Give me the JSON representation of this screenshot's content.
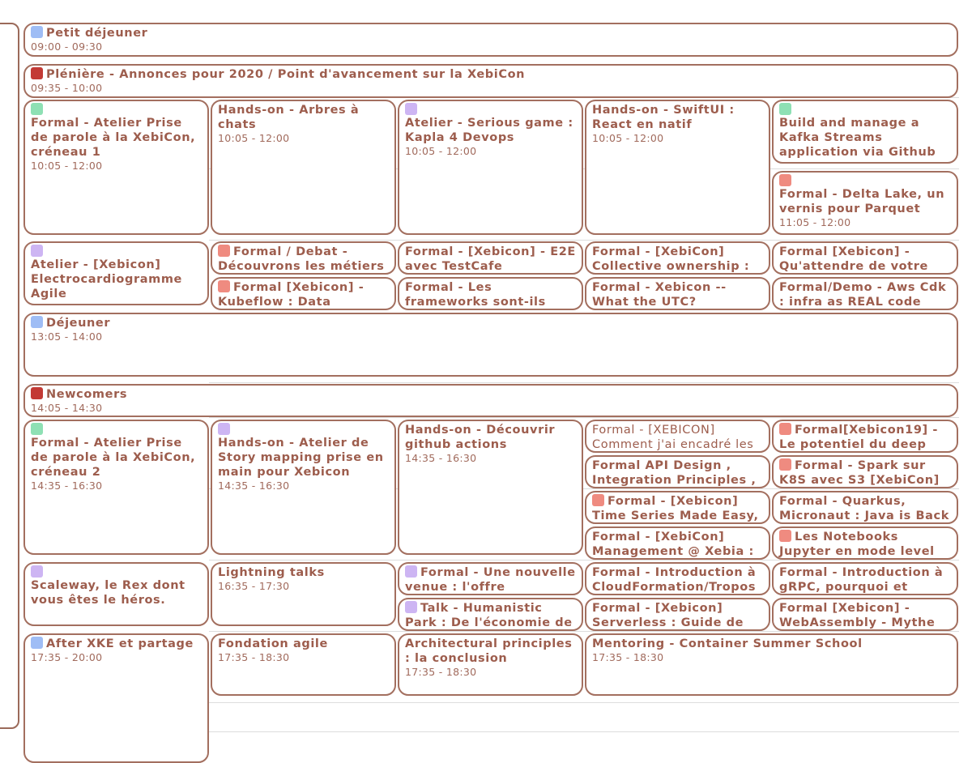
{
  "colors": {
    "border": "#a36f5f",
    "text": "#9d5d4d",
    "blue": "#9fbdf5",
    "red": "#c33a35",
    "green": "#8ee0b4",
    "purple": "#cdb5f3",
    "salmon": "#ef8b80"
  },
  "events": {
    "e1": {
      "title": "Petit déjeuner",
      "time": "09:00 - 09:30",
      "color": "blue"
    },
    "e2": {
      "title": "Plénière - Annonces pour 2020 / Point d'avancement sur la XebiCon",
      "time": "09:35 - 10:00",
      "color": "red"
    },
    "e3": {
      "title": "Formal - Atelier Prise de parole à la XebiCon, créneau 1",
      "time": "10:05 - 12:00",
      "color": "green"
    },
    "e4": {
      "title": "Hands-on - Arbres à chats",
      "time": "10:05 - 12:00"
    },
    "e5": {
      "title": "Atelier - Serious game : Kapla 4 Devops",
      "time": "10:05 - 12:00",
      "color": "purple"
    },
    "e6": {
      "title": "Hands-on - SwiftUI : React en natif",
      "time": "10:05 - 12:00"
    },
    "e7": {
      "title": "Build and manage a Kafka Streams application via Github",
      "color": "green"
    },
    "e8": {
      "title": "Formal - Delta Lake, un vernis pour Parquet",
      "time": "11:05 - 12:00",
      "color": "salmon"
    },
    "e9": {
      "title": "Atelier - [Xebicon] Electrocardiogramme Agile",
      "color": "purple"
    },
    "e10": {
      "title": "Formal / Debat - Découvrons les métiers",
      "color": "salmon"
    },
    "e11": {
      "title": "Formal - [Xebicon] - E2E avec TestCafe"
    },
    "e12": {
      "title": "Formal - [XebiCon] Collective ownership :"
    },
    "e13": {
      "title": "Formal [Xebicon] - Qu'attendre de votre"
    },
    "e14": {
      "title": "Formal [Xebicon] - Kubeflow : Data",
      "color": "salmon"
    },
    "e15": {
      "title": "Formal - Les frameworks sont-ils"
    },
    "e16": {
      "title": "Formal - Xebicon -- What the UTC?"
    },
    "e17": {
      "title": "Formal/Demo - Aws Cdk : infra as REAL code"
    },
    "e18": {
      "title": "Déjeuner",
      "time": "13:05 - 14:00",
      "color": "blue"
    },
    "e19": {
      "title": "Newcomers",
      "time": "14:05 - 14:30",
      "color": "red"
    },
    "e20": {
      "title": "Formal - Atelier Prise de parole à la XebiCon, créneau 2",
      "time": "14:35 - 16:30",
      "color": "green"
    },
    "e21": {
      "title": "Hands-on - Atelier de Story mapping prise en main pour Xebicon",
      "time": "14:35 - 16:30",
      "color": "purple"
    },
    "e22": {
      "title": "Hands-on - Découvrir github actions",
      "time": "14:35 - 16:30"
    },
    "e23": {
      "title": "Formal - [XEBICON] Comment j'ai encadré les"
    },
    "e24": {
      "title": "Formal[Xebicon19] - Le potentiel du deep",
      "color": "salmon"
    },
    "e25": {
      "title": "Formal API Design , Integration Principles ,"
    },
    "e26": {
      "title": "Formal - Spark sur K8S avec S3 [XebiCon]",
      "color": "salmon"
    },
    "e27": {
      "title": "Formal - [Xebicon] Time Series Made Easy,",
      "color": "salmon"
    },
    "e28": {
      "title": "Formal - Quarkus, Micronaut : Java is Back"
    },
    "e29": {
      "title": "Formal - [XebiCon] Management @ Xebia :"
    },
    "e30": {
      "title": "Les Notebooks Jupyter en mode level",
      "color": "salmon"
    },
    "e31": {
      "title": "Scaleway, le Rex dont vous êtes le héros.",
      "color": "purple"
    },
    "e32": {
      "title": "Lightning talks",
      "time": "16:35 - 17:30"
    },
    "e33": {
      "title": "Formal - Une nouvelle venue : l'offre",
      "color": "purple"
    },
    "e34": {
      "title": "Formal - Introduction à CloudFormation/Tropos"
    },
    "e35": {
      "title": "Formal - Introduction à gRPC, pourquoi et"
    },
    "e36": {
      "title": "Talk - Humanistic Park : De l'économie de",
      "color": "purple"
    },
    "e37": {
      "title": "Formal - [Xebicon] Serverless : Guide de"
    },
    "e38": {
      "title": "Formal [Xebicon] - WebAssembly - Mythe"
    },
    "e39": {
      "title": "After XKE et partage",
      "time": "17:35 - 20:00",
      "color": "blue"
    },
    "e40": {
      "title": "Fondation agile",
      "time": "17:35 - 18:30"
    },
    "e41": {
      "title": "Architectural principles : la conclusion",
      "time": "17:35 - 18:30"
    },
    "e42": {
      "title": "Mentoring - Container Summer School",
      "time": "17:35 - 18:30"
    }
  }
}
